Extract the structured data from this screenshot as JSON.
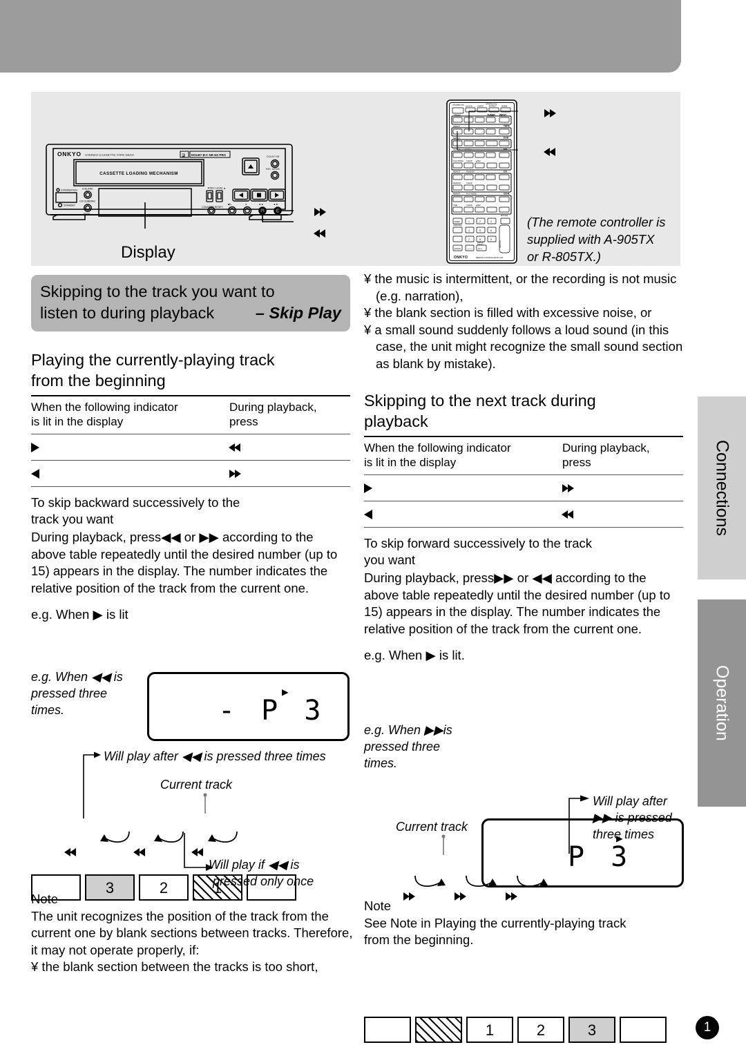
{
  "illustration": {
    "display_caption": "Display",
    "deck": {
      "brand": "ONKYO",
      "model_text": "STEREO CASSETTE TAPE DECK",
      "dolby_text": "DOLBY B-C NR HX PRO",
      "loading_text": "CASSETTE LOADING MECHANISM",
      "labels": [
        "STANDBY/ON",
        "STANDBY",
        "A.BLANK",
        "CD DUBBING",
        "FADE",
        "REC LEVEL",
        "COUNTER RESET",
        "DOLBY NR",
        "REV. MODE"
      ]
    },
    "remote": {
      "brand": "ONKYO",
      "footer_text": "REMOTE CONTROLLER  RC-430",
      "top_labels": [
        "STANDBY/ON",
        "CLOCK",
        "SLEEP",
        "GRAPHIC EQ",
        "EFFECT",
        "MODE"
      ],
      "note_line1": "(The remote controller is",
      "note_line2": "supplied with A-905TX",
      "note_line3": "or R-805TX.)"
    },
    "callouts": {
      "deck_ff": "▶▶",
      "deck_rew": "◀◀",
      "remote_ff": "▶▶",
      "remote_rew": "◀◀"
    }
  },
  "left_column": {
    "banner": {
      "line1": "Skipping to the track you want to",
      "line2": "listen to during playback",
      "skip_play": "– Skip Play"
    },
    "section_title_line1": "Playing the currently-playing track",
    "section_title_line2": "from the beginning",
    "table": {
      "head_col1_line1": "When the following indicator",
      "head_col1_line2": "is lit in the display",
      "head_col2_line1": "During playback,",
      "head_col2_line2": "press",
      "rows": [
        {
          "indicator": "play-right",
          "press": "rewind"
        },
        {
          "indicator": "play-left",
          "press": "fastforward"
        }
      ]
    },
    "subhead_line1": "To skip backward successively to the",
    "subhead_line2": "track you want",
    "paragraph": "During playback, press◀◀ or ▶▶ according to the above table repeatedly until the desired number (up to 15) appears in the display. The number indicates the relative position of the track from the current one.",
    "eg_lit": "e.g. When ▶ is lit",
    "eg_pressed_line1": "e.g. When ◀◀ is",
    "eg_pressed_line2": "pressed three",
    "eg_pressed_line3": "times.",
    "lcd_value": "- P   3",
    "lcd_indicator": "▶",
    "annotation_will_play": "Will play after ◀◀ is pressed three times",
    "annotation_current_track": "Current track",
    "annotation_once_line1": "Will play if ◀◀ is",
    "annotation_once_line2": "pressed only once",
    "strip_cells": [
      "",
      "3",
      "2",
      "1",
      ""
    ],
    "strip_highlight_index": 1,
    "strip_hatched_index": 3,
    "strip_arrow_glyph": "◀◀",
    "note_title": "Note",
    "note_body": "The unit recognizes the position of the track from the current one by blank sections between tracks. Therefore, it may not operate properly, if:",
    "note_bullet": "¥  the blank section between the tracks is too short,"
  },
  "right_column": {
    "bullets": [
      "¥ the music is intermittent, or the recording is not music (e.g. narration),",
      "¥ the blank section is filled with excessive noise, or",
      "¥ a small sound suddenly follows a loud sound (in this case, the unit might recognize the small sound section as blank by mistake)."
    ],
    "section_title_line1": "Skipping to the next track during",
    "section_title_line2": "playback",
    "table": {
      "head_col1_line1": "When the following indicator",
      "head_col1_line2": "is lit in the display",
      "head_col2_line1": "During playback,",
      "head_col2_line2": "press",
      "rows": [
        {
          "indicator": "play-right",
          "press": "fastforward"
        },
        {
          "indicator": "play-left",
          "press": "rewind"
        }
      ]
    },
    "subhead_line1": "To skip forward successively to the track",
    "subhead_line2": "you want",
    "paragraph": "During playback, press▶▶ or ◀◀ according to the above table repeatedly until the desired number (up to 15) appears in the display. The number indicates the relative position of the track from the current one.",
    "eg_lit": "e.g. When ▶ is lit.",
    "eg_pressed_line1": "e.g. When ▶▶is",
    "eg_pressed_line2": "pressed three",
    "eg_pressed_line3": "times.",
    "lcd_value": "P   3",
    "lcd_indicator": "▶",
    "annotation_will_play_line1": "Will play after",
    "annotation_will_play_line2": "▶▶ is pressed",
    "annotation_will_play_line3": "three times",
    "annotation_current_track": "Current track",
    "strip_cells": [
      "",
      "",
      "1",
      "2",
      "3",
      ""
    ],
    "strip_highlight_index": 4,
    "strip_hatched_index": 1,
    "strip_arrow_glyph": "▶▶",
    "note_title": "Note",
    "note_body_line1": "See  Note   in   Playing the currently-playing track",
    "note_body_line2": "from the beginning."
  },
  "side_tabs": [
    {
      "label": "Connections",
      "active": false
    },
    {
      "label": "Operation",
      "active": true
    }
  ],
  "page_number": "1",
  "colors": {
    "header_band": "#9b9b9b",
    "illustration_bg": "#e8e8e8",
    "banner_bg": "#b4b4b4",
    "tab_inactive": "#cfcfcf",
    "tab_active": "#949494",
    "highlight_cell": "#cfcfcf"
  }
}
